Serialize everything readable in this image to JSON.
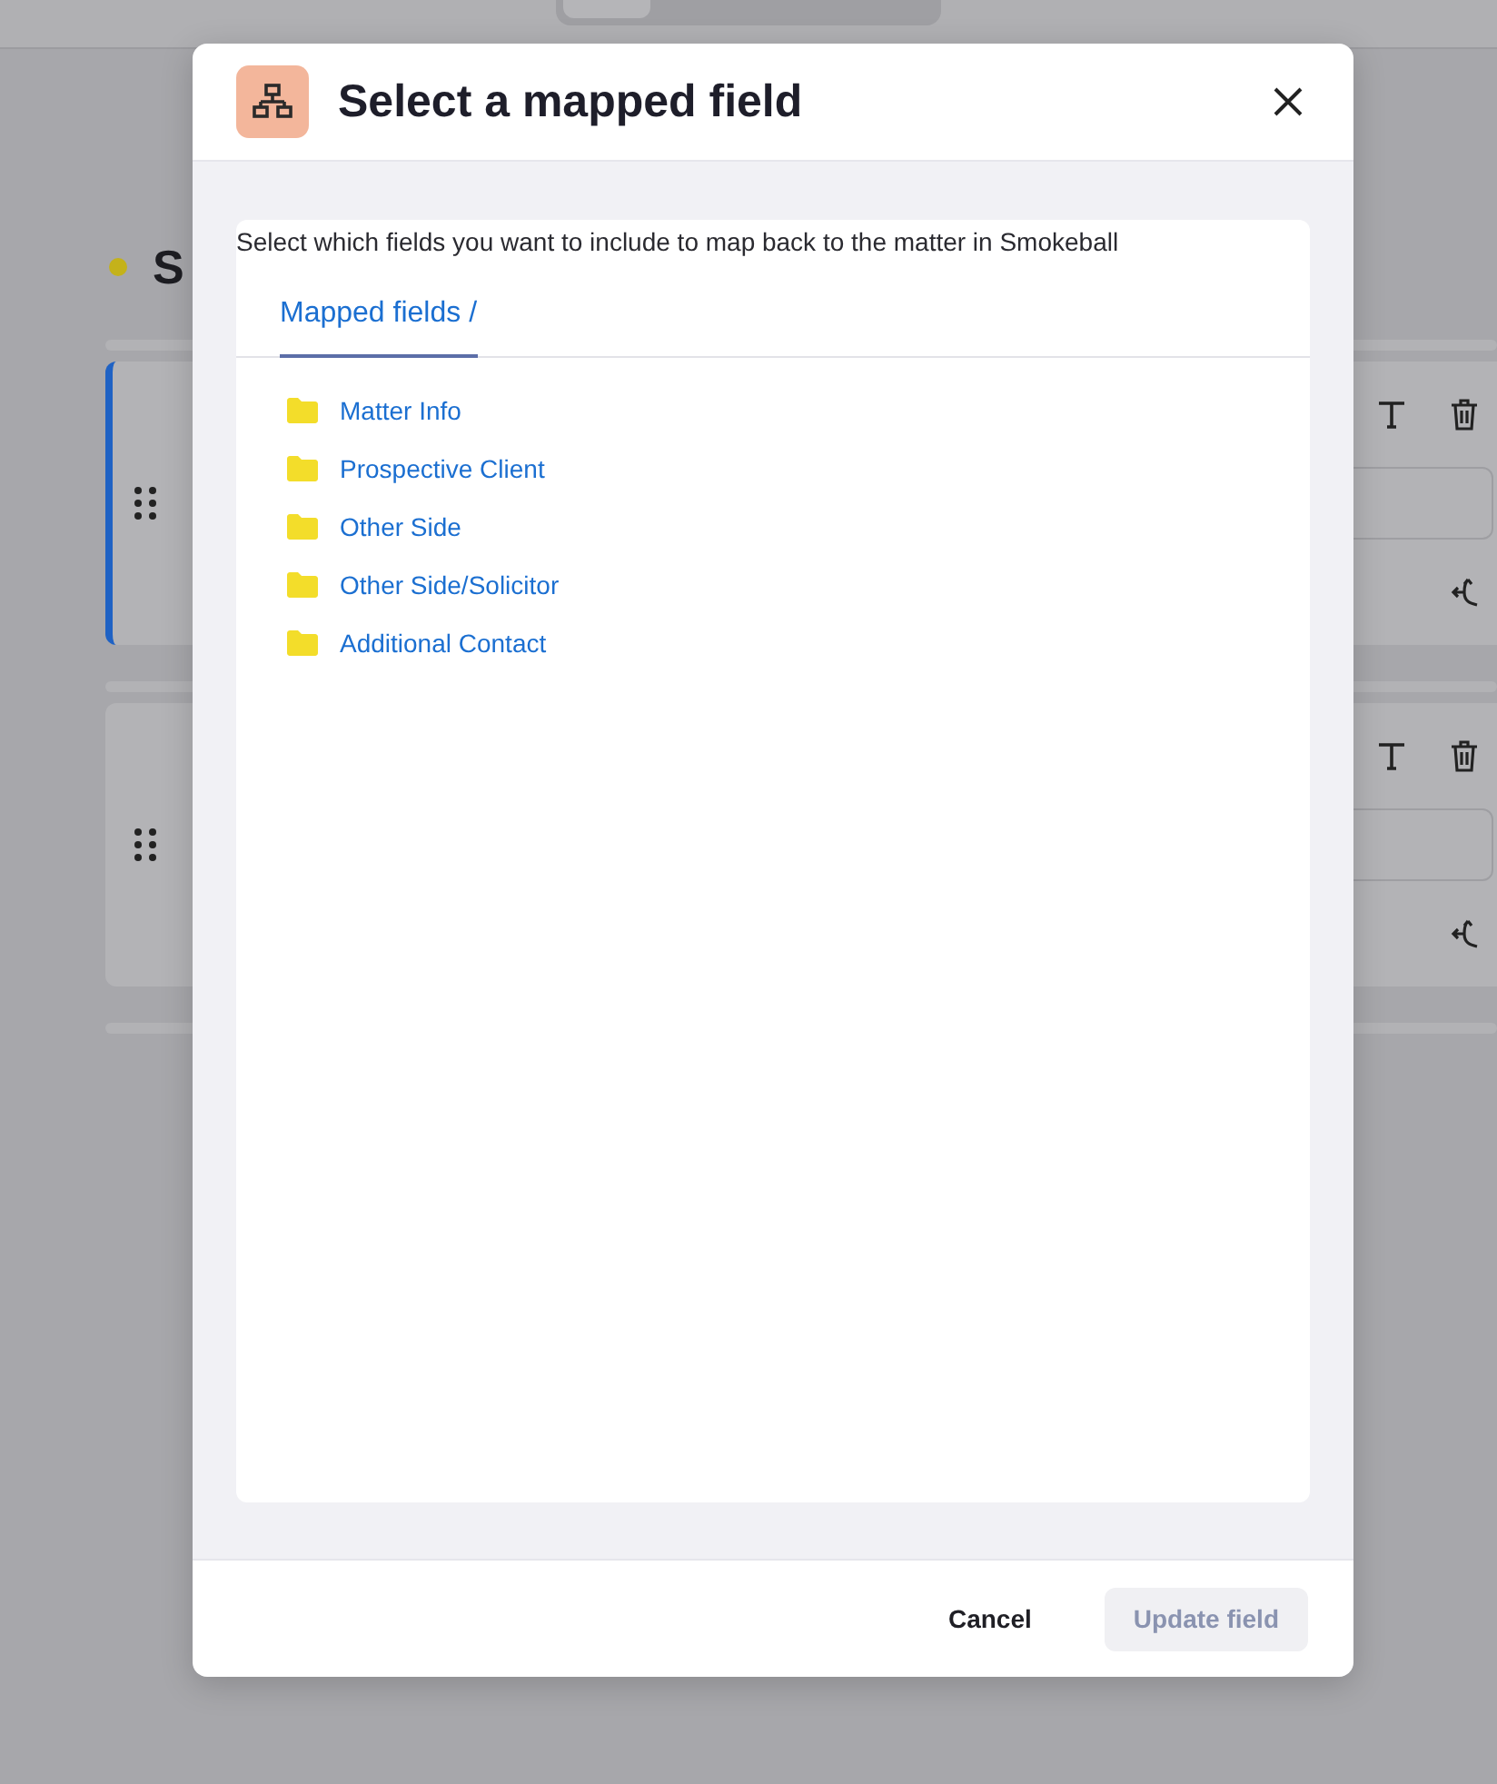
{
  "page": {
    "heading": "S",
    "cards": [
      {
        "selected": true
      },
      {
        "selected": false
      }
    ]
  },
  "dialog": {
    "title": "Select a mapped field",
    "description": "Select which fields you want to include to map back to the matter in Smokeball",
    "tabs": [
      {
        "label": "Mapped fields /",
        "selected": true
      }
    ],
    "folders": [
      {
        "label": "Matter Info"
      },
      {
        "label": "Prospective Client"
      },
      {
        "label": "Other Side"
      },
      {
        "label": "Other Side/Solicitor"
      },
      {
        "label": "Additional Contact"
      }
    ],
    "buttons": [
      {
        "label": "Cancel",
        "kind": "secondary",
        "disabled": false
      },
      {
        "label": "Update field",
        "kind": "primary",
        "disabled": true
      }
    ]
  }
}
